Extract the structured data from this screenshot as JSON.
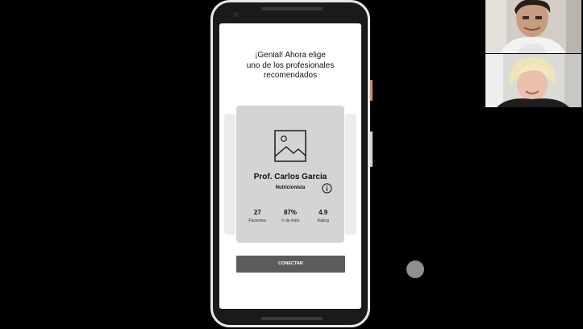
{
  "screen": {
    "heading_lines": [
      "¡Genial! Ahora elige",
      "uno de los profesionales",
      "recomendados"
    ]
  },
  "profile_card": {
    "name": "Prof. Carlos Garcia",
    "role": "Nutricionista",
    "image_icon": "image-placeholder-icon",
    "info_icon": "info-icon",
    "stats": [
      {
        "value": "27",
        "label": "Pacientes"
      },
      {
        "value": "87%",
        "label": "½ de éxito"
      },
      {
        "value": "4.9",
        "label": "Rating"
      }
    ]
  },
  "actions": {
    "connect_label": "CONECTAR"
  },
  "video_participants": [
    {
      "name": "participant-1"
    },
    {
      "name": "participant-2"
    }
  ],
  "colors": {
    "background": "#000000",
    "screen": "#ffffff",
    "card": "#d4d4d4",
    "button": "#5c5c5c"
  }
}
